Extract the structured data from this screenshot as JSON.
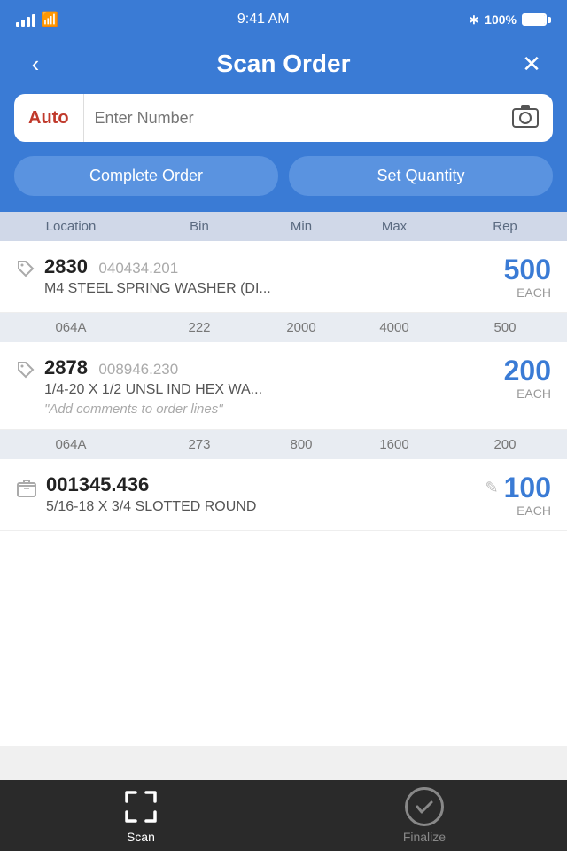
{
  "statusBar": {
    "time": "9:41 AM",
    "battery": "100%"
  },
  "header": {
    "title": "Scan Order",
    "back_label": "‹",
    "close_label": "✕"
  },
  "searchBar": {
    "auto_label": "Auto",
    "placeholder": "Enter Number"
  },
  "buttons": {
    "complete_order": "Complete Order",
    "set_quantity": "Set Quantity"
  },
  "columns": {
    "location": "Location",
    "bin": "Bin",
    "min": "Min",
    "max": "Max",
    "rep": "Rep"
  },
  "items": [
    {
      "id": "item-1",
      "number": "2830",
      "sku": "040434.201",
      "name": "M4 STEEL SPRING WASHER (DI...",
      "quantity": "500",
      "unit": "EACH",
      "comment": null,
      "icon_type": "tag",
      "location": "064A",
      "bin": "222",
      "min": "2000",
      "max": "4000",
      "rep": "500"
    },
    {
      "id": "item-2",
      "number": "2878",
      "sku": "008946.230",
      "name": "1/4-20 X 1/2 UNSL IND HEX WA...",
      "quantity": "200",
      "unit": "EACH",
      "comment": "\"Add comments to order lines\"",
      "icon_type": "tag",
      "location": "064A",
      "bin": "273",
      "min": "800",
      "max": "1600",
      "rep": "200"
    },
    {
      "id": "item-3",
      "number": "001345.436",
      "sku": null,
      "name": "5/16-18 X 3/4 SLOTTED ROUND",
      "quantity": "100",
      "unit": "EACH",
      "comment": null,
      "icon_type": "box",
      "has_pencil": true,
      "location": "",
      "bin": "",
      "min": "",
      "max": "",
      "rep": ""
    }
  ],
  "bottomNav": {
    "scan_label": "Scan",
    "finalize_label": "Finalize"
  }
}
